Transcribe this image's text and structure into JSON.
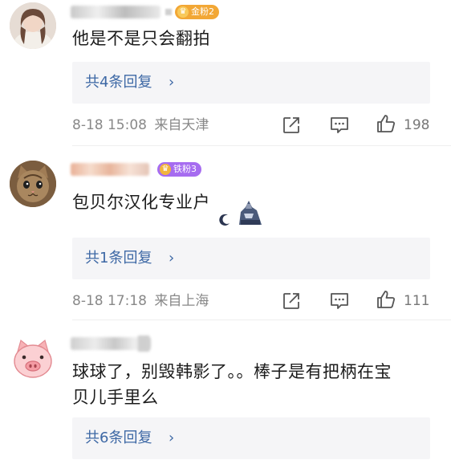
{
  "comments": [
    {
      "badge": "金粉2",
      "text": "他是不是只会翻拍",
      "reply_label": "共4条回复",
      "reply_chevron": "›",
      "date": "8-18 15:08",
      "source": "来自天津",
      "likes": "198",
      "badge_color": "#f2a735",
      "avatar_icon": "person-photo-avatar"
    },
    {
      "badge": "铁粉3",
      "text": "包贝尔汉化专业户",
      "reply_label": "共1条回复",
      "reply_chevron": "›",
      "date": "8-18 17:18",
      "source": "来自上海",
      "likes": "111",
      "badge_color": "#a66cf0",
      "avatar_icon": "cat-avatar"
    },
    {
      "text_line1": "球球了，别毁韩影了。。棒子是有把柄在宝",
      "text_line2": "贝儿手里么",
      "reply_label": "共6条回复",
      "reply_chevron": "›",
      "avatar_icon": "pig-avatar"
    }
  ],
  "icons": {
    "share": "share-icon",
    "comment": "comment-icon",
    "like": "thumbs-up-icon"
  }
}
